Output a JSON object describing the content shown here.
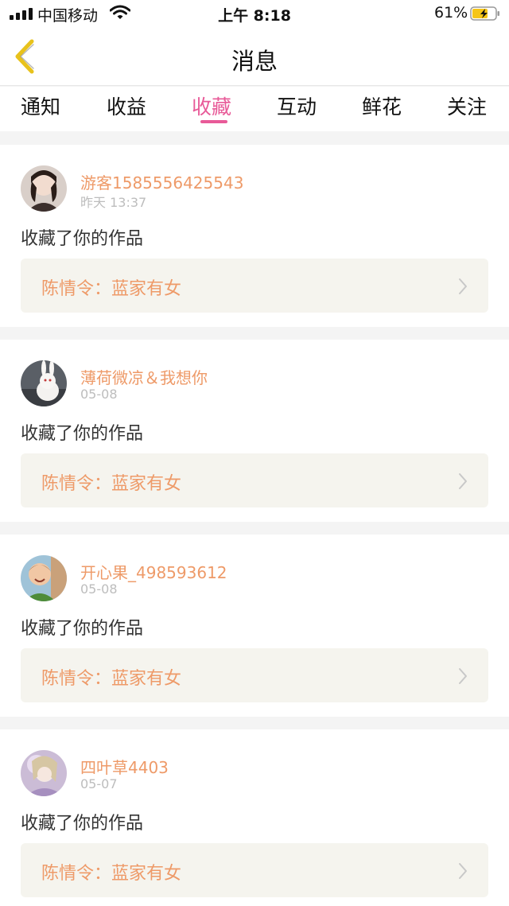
{
  "status_bar": {
    "carrier": "中国移动",
    "time": "上午 8:18",
    "battery_percent": "61%"
  },
  "nav": {
    "title": "消息",
    "back_icon": "chevron-left-icon"
  },
  "tabs": [
    {
      "label": "通知",
      "active": false
    },
    {
      "label": "收益",
      "active": false
    },
    {
      "label": "收藏",
      "active": true
    },
    {
      "label": "互动",
      "active": false
    },
    {
      "label": "鲜花",
      "active": false
    },
    {
      "label": "关注",
      "active": false
    }
  ],
  "notifications": [
    {
      "username": "游客1585556425543",
      "time": "昨天 13:37",
      "action": "收藏了你的作品",
      "work": "陈情令：蓝家有女"
    },
    {
      "username": "薄荷微凉＆我想你",
      "time": "05-08",
      "action": "收藏了你的作品",
      "work": "陈情令：蓝家有女"
    },
    {
      "username": "开心果_498593612",
      "time": "05-08",
      "action": "收藏了你的作品",
      "work": "陈情令：蓝家有女"
    },
    {
      "username": "四叶草4403",
      "time": "05-07",
      "action": "收藏了你的作品",
      "work": "陈情令：蓝家有女"
    }
  ],
  "colors": {
    "accent": "#e85a98",
    "username": "#ee9a68",
    "back_arrow": "#e8c21c"
  }
}
